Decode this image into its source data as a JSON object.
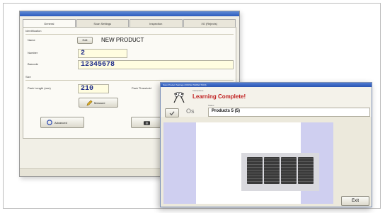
{
  "main_window": {
    "tabs": [
      "General",
      "Scan Settings",
      "Inspection",
      "I/O (Rejects)"
    ],
    "identification": {
      "group_label": "Identification",
      "name_label": "Name",
      "edit_button": "Edit",
      "name_value": "NEW PRODUCT",
      "number_label": "Number",
      "number_value": "2",
      "barcode_label": "Barcode",
      "barcode_value": "12345678"
    },
    "size": {
      "group_label": "Size",
      "pack_length_label": "Pack Length (mm)",
      "pack_length_value": "210",
      "pack_threshold_label": "Pack Threshold",
      "measure_button": "Measure"
    },
    "advanced_button": "Advanced"
  },
  "dialog": {
    "title": "Scan Product Settings (FINISH INSPECTION)",
    "instructions_label": "Instructions",
    "message": "Learning Complete!",
    "status_label": "Status",
    "status_value": "Products 5 (5)",
    "os_label": "Os",
    "exit_button": "Exit"
  }
}
